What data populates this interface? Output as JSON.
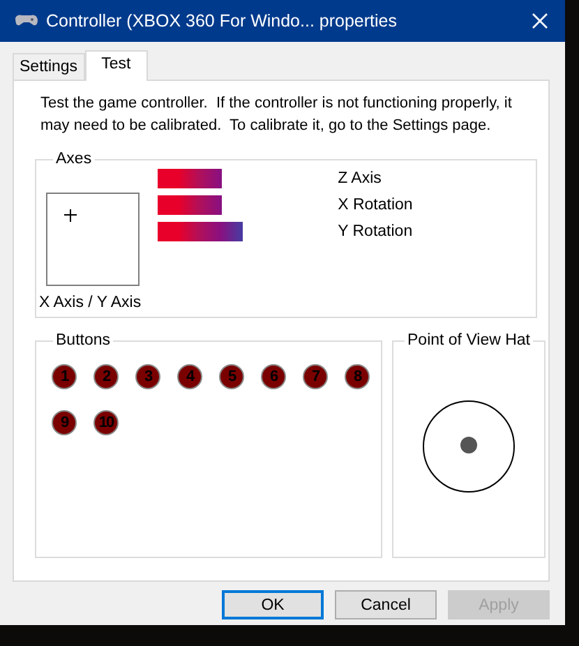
{
  "window": {
    "title": "Controller (XBOX 360 For Windo... properties"
  },
  "tabs": [
    {
      "label": "Settings",
      "selected": false
    },
    {
      "label": "Test",
      "selected": true
    }
  ],
  "intro": "Test the game controller.  If the controller is not functioning properly, it may need to be calibrated.  To calibrate it, go to the Settings page.",
  "axes": {
    "title": "Axes",
    "xy_label": "X Axis / Y Axis",
    "bars": [
      {
        "label": "Z Axis"
      },
      {
        "label": "X Rotation"
      },
      {
        "label": "Y Rotation"
      }
    ]
  },
  "buttons_group": {
    "title": "Buttons",
    "buttons": [
      {
        "label": "1",
        "pressed": false
      },
      {
        "label": "2",
        "pressed": false
      },
      {
        "label": "3",
        "pressed": false
      },
      {
        "label": "4",
        "pressed": false
      },
      {
        "label": "5",
        "pressed": false
      },
      {
        "label": "6",
        "pressed": false
      },
      {
        "label": "7",
        "pressed": false
      },
      {
        "label": "8",
        "pressed": false
      },
      {
        "label": "9",
        "pressed": false
      },
      {
        "label": "10",
        "pressed": false
      }
    ]
  },
  "pov": {
    "title": "Point of View Hat"
  },
  "dialog_buttons": [
    {
      "label": "OK",
      "default": true,
      "disabled": false
    },
    {
      "label": "Cancel",
      "default": false,
      "disabled": false
    },
    {
      "label": "Apply",
      "default": false,
      "disabled": true
    }
  ]
}
